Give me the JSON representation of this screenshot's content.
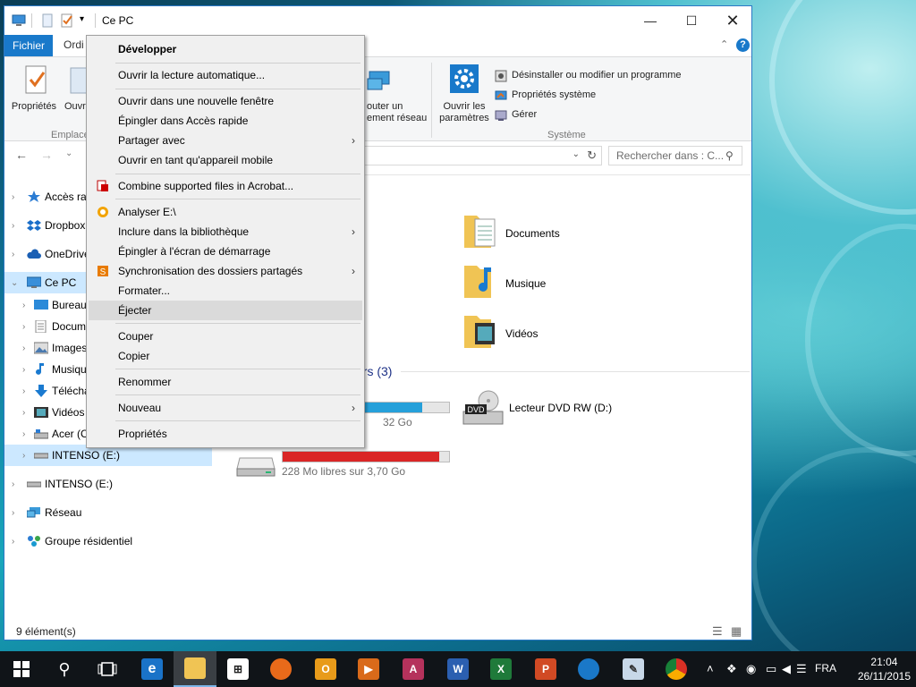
{
  "window": {
    "title": "Ce PC"
  },
  "ribbon": {
    "tab_file": "Fichier",
    "tab_computer": "Ordi",
    "btn_properties": "Propriétés",
    "btn_open": "Ouvr",
    "group_location": "Emplace",
    "btn_map_network_1": "outer un",
    "btn_map_network_2": "ement réseau",
    "btn_open_settings_1": "Ouvrir les",
    "btn_open_settings_2": "paramètres",
    "btn_uninstall": "Désinstaller ou modifier un programme",
    "btn_system_props": "Propriétés système",
    "btn_manage": "Gérer",
    "group_system": "Système"
  },
  "search": {
    "placeholder": "Rechercher dans : C..."
  },
  "navpane": {
    "items": [
      {
        "label": "Accès rap",
        "icon": "star-icon"
      },
      {
        "label": "Dropbox",
        "icon": "dropbox-icon"
      },
      {
        "label": "OneDrive",
        "icon": "cloud-icon"
      },
      {
        "label": "Ce PC",
        "icon": "computer-icon"
      },
      {
        "label": "Bureau",
        "icon": "desktop-icon"
      },
      {
        "label": "Docum",
        "icon": "document-icon"
      },
      {
        "label": "Images",
        "icon": "picture-icon"
      },
      {
        "label": "Musiqu",
        "icon": "music-icon"
      },
      {
        "label": "Télécha",
        "icon": "download-icon"
      },
      {
        "label": "Vidéos",
        "icon": "video-icon"
      },
      {
        "label": "Acer (C",
        "icon": "drive-icon"
      },
      {
        "label": "INTENSO (E:)",
        "icon": "usb-drive-icon"
      },
      {
        "label": "INTENSO (E:)",
        "icon": "usb-drive-icon"
      },
      {
        "label": "Réseau",
        "icon": "network-icon"
      },
      {
        "label": "Groupe résidentiel",
        "icon": "homegroup-icon"
      }
    ]
  },
  "content": {
    "folders": [
      {
        "label": "Documents"
      },
      {
        "label": "Musique"
      },
      {
        "label": "Vidéos"
      }
    ],
    "devices_header": "urs (3)",
    "drive_c_size": "32 Go",
    "drive_e_size": "228 Mo libres sur 3,70 Go",
    "dvd_label": "Lecteur DVD RW (D:)",
    "dvd_badge": "DVD",
    "drive_c_usage": 0.84,
    "drive_e_usage": 0.94,
    "usage_color": "#da2626"
  },
  "context_menu": {
    "items": [
      {
        "label": "Développer",
        "bold": true
      },
      {
        "label": "Ouvrir la lecture automatique..."
      },
      {
        "label": "Ouvrir dans une nouvelle fenêtre"
      },
      {
        "label": "Épingler dans Accès rapide"
      },
      {
        "label": "Partager avec",
        "submenu": true
      },
      {
        "label": "Ouvrir en tant qu'appareil mobile"
      },
      {
        "label": "Combine supported files in Acrobat...",
        "icon": "acrobat-icon"
      },
      {
        "label": "Analyser E:\\",
        "icon": "scan-icon"
      },
      {
        "label": "Inclure dans la bibliothèque",
        "submenu": true
      },
      {
        "label": "Épingler à l'écran de démarrage"
      },
      {
        "label": "Synchronisation des dossiers partagés",
        "icon": "sync-icon",
        "submenu": true
      },
      {
        "label": "Formater..."
      },
      {
        "label": "Éjecter",
        "highlighted": true
      },
      {
        "label": "Couper"
      },
      {
        "label": "Copier"
      },
      {
        "label": "Renommer"
      },
      {
        "label": "Nouveau",
        "submenu": true
      },
      {
        "label": "Propriétés"
      }
    ]
  },
  "status": {
    "count": "9 élément(s)"
  },
  "taskbar": {
    "lang": "FRA",
    "time": "21:04",
    "date": "26/11/2015"
  }
}
